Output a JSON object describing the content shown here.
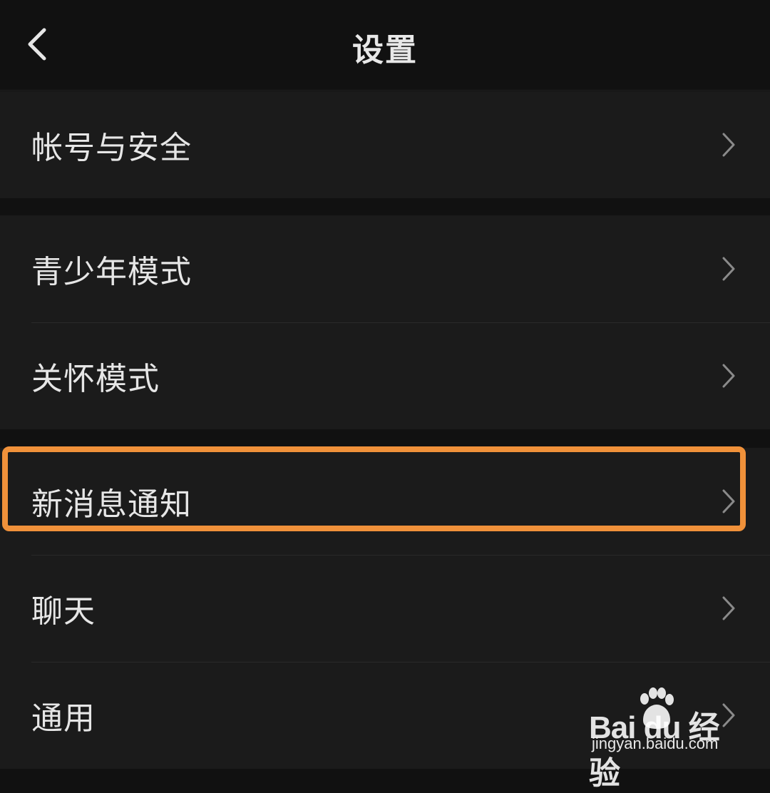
{
  "header": {
    "title": "设置",
    "back_icon": "chevron-left-icon"
  },
  "groups": [
    {
      "items": [
        {
          "label": "帐号与安全"
        }
      ]
    },
    {
      "items": [
        {
          "label": "青少年模式"
        },
        {
          "label": "关怀模式"
        }
      ]
    },
    {
      "items": [
        {
          "label": "新消息通知"
        },
        {
          "label": "聊天"
        },
        {
          "label": "通用"
        }
      ]
    }
  ],
  "highlight": {
    "target": "新消息通知",
    "color": "#f0913a"
  },
  "watermark": {
    "brand": "Bai du 经验",
    "url": "jingyan.baidu.com"
  },
  "colors": {
    "background": "#111111",
    "row_background": "#1b1b1b",
    "text": "#e6e6e6",
    "chevron": "#8a8a8a"
  }
}
